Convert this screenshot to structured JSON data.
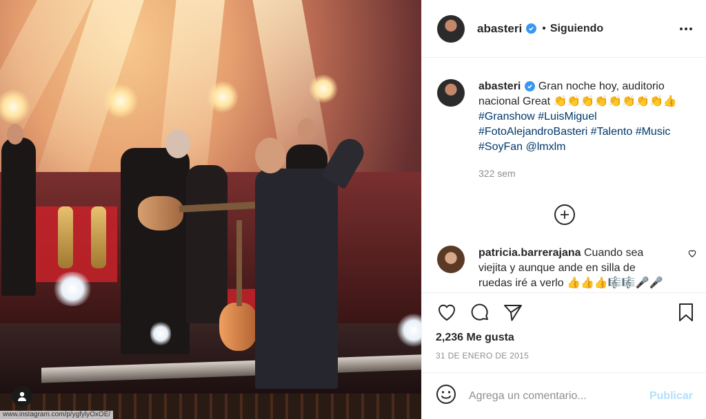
{
  "post": {
    "author": "abasteri",
    "follow_status": "Siguiendo",
    "caption": {
      "lines": [
        "Gran noche hoy, auditorio",
        "nacional Great 👏👏👏👏👏👏👏👏👍"
      ],
      "tags_line1": "#Granshow #LuisMiguel",
      "tags_line2": "#FotoAlejandroBasteri #Talento #Music",
      "tags_line3": "#SoyFan @lmxlm",
      "time": "322 sem"
    },
    "comment": {
      "author": "patricia.barrerajana",
      "text_line1": "Cuando sea",
      "text_line2": "viejita y aunque ande en silla de",
      "text_line3": "ruedas iré a verlo 👍👍👍🎼🎼🎤🎤"
    },
    "likes": "2,236 Me gusta",
    "date": "31 DE ENERO DE 2015",
    "add_comment": {
      "placeholder": "Agrega un comentario...",
      "publish_label": "Publicar"
    },
    "photo_url": "www.instagram.com/p/ygfylyOxOE/"
  },
  "colors": {
    "verified": "#3897f0",
    "hashtag": "#00376b",
    "publish_disabled": "#b2dffc",
    "muted": "#8e8e8e"
  },
  "icons": [
    "more-options-icon",
    "verified-badge-icon",
    "load-more-icon",
    "comment-like-icon",
    "heart-icon",
    "comment-icon",
    "share-icon",
    "bookmark-icon",
    "emoji-icon",
    "user-tag-icon"
  ]
}
